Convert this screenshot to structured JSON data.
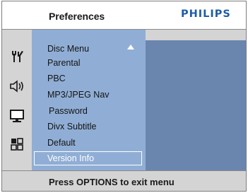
{
  "header": {
    "title": "Preferences",
    "brand": "PHILIPS",
    "brand_color": "#1d5ca8"
  },
  "sidebar_icons": [
    {
      "name": "tools-icon"
    },
    {
      "name": "speaker-icon"
    },
    {
      "name": "monitor-icon"
    },
    {
      "name": "grid-icon"
    }
  ],
  "menu": {
    "items": [
      {
        "label": "Disc Menu"
      },
      {
        "label": "Parental"
      },
      {
        "label": "PBC"
      },
      {
        "label": "MP3/JPEG Nav"
      },
      {
        "label": "Password"
      },
      {
        "label": "Divx Subtitle"
      },
      {
        "label": "Default"
      },
      {
        "label": "Version Info"
      }
    ],
    "selected_index": 7,
    "scroll_indicator": "up-arrow"
  },
  "footer": {
    "hint": "Press OPTIONS to exit menu"
  },
  "colors": {
    "menu_bg": "#90aed5",
    "panel_bg": "#6a86af",
    "chrome_bg": "#d4d4d4"
  }
}
